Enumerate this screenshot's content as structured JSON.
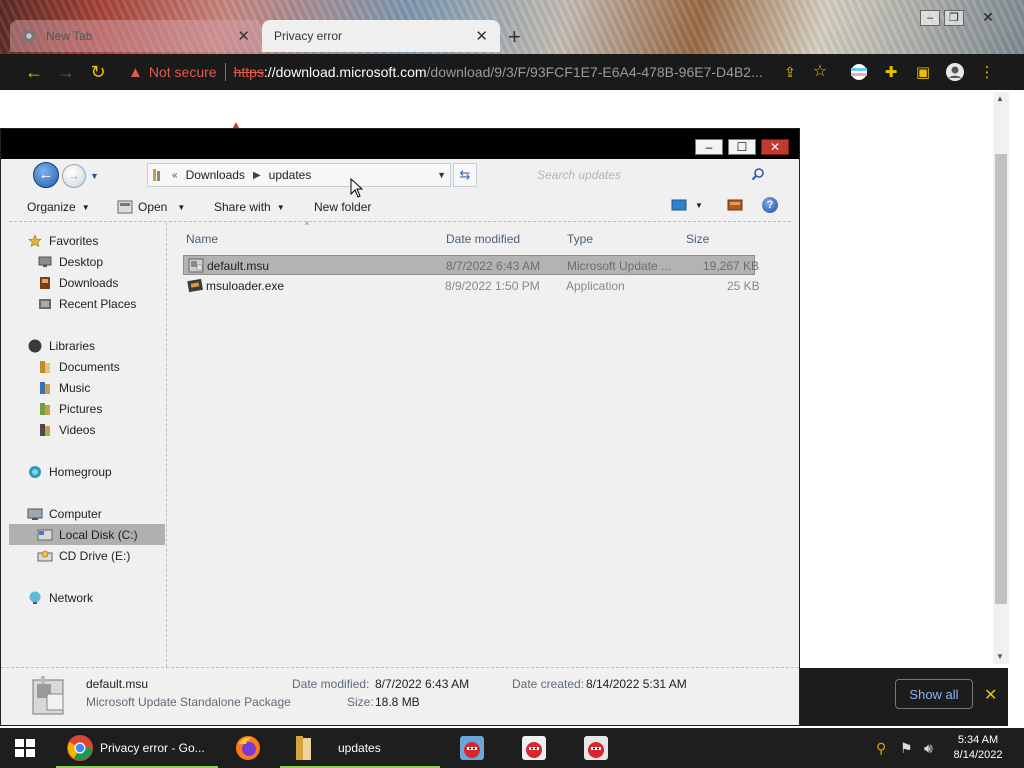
{
  "browser": {
    "tabs": [
      {
        "title": "New Tab",
        "active": false
      },
      {
        "title": "Privacy error",
        "active": true
      }
    ],
    "security": "Not secure",
    "url_scheme": "https",
    "url_host": "://download.microsoft.com",
    "url_path": "/download/9/3/F/93FCF1E7-E6A4-478B-96E7-D4B2...",
    "downloads_bar": {
      "show_all": "Show all"
    }
  },
  "explorer": {
    "breadcrumb": {
      "prefix": "«",
      "items": [
        "Downloads",
        "updates"
      ]
    },
    "search_placeholder": "Search updates",
    "commands": {
      "organize": "Organize",
      "open": "Open",
      "share_with": "Share with",
      "new_folder": "New folder"
    },
    "nav": {
      "favorites": "Favorites",
      "desktop": "Desktop",
      "downloads": "Downloads",
      "recent_places": "Recent Places",
      "libraries": "Libraries",
      "documents": "Documents",
      "music": "Music",
      "pictures": "Pictures",
      "videos": "Videos",
      "homegroup": "Homegroup",
      "computer": "Computer",
      "local_disk": "Local Disk (C:)",
      "cd_drive": "CD Drive (E:)",
      "network": "Network"
    },
    "columns": {
      "name": "Name",
      "date": "Date modified",
      "type": "Type",
      "size": "Size"
    },
    "files": [
      {
        "name": "default.msu",
        "date": "8/7/2022 6:43 AM",
        "type": "Microsoft Update ...",
        "size": "19,267 KB",
        "selected": true
      },
      {
        "name": "msuloader.exe",
        "date": "8/9/2022 1:50 PM",
        "type": "Application",
        "size": "25 KB",
        "selected": false
      }
    ],
    "details": {
      "name": "default.msu",
      "kind": "Microsoft Update Standalone Package",
      "date_modified_label": "Date modified:",
      "date_modified": "8/7/2022 6:43 AM",
      "date_created_label": "Date created:",
      "date_created": "8/14/2022 5:31 AM",
      "size_label": "Size:",
      "size": "18.8 MB"
    }
  },
  "taskbar": {
    "chrome_label": "Privacy error - Go...",
    "explorer_label": "updates",
    "time": "5:34 AM",
    "date": "8/14/2022"
  },
  "colors": {
    "not_secure": "#e35b4a",
    "chrome_toolbar": "#1a1a1a",
    "selection": "#b3b3b3",
    "taskbar": "#1e1e1e"
  }
}
